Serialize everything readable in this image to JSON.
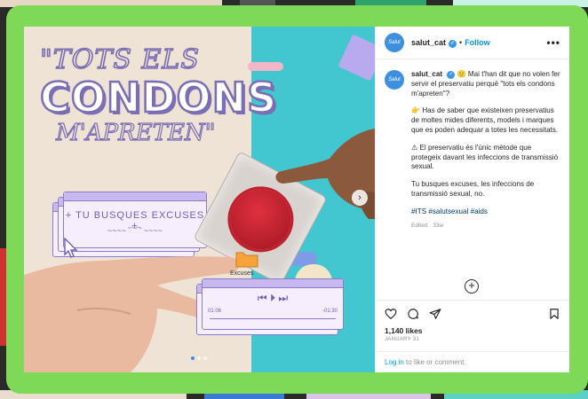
{
  "post": {
    "username": "salut_cat",
    "avatar_text": "Salut",
    "follow_label": "Follow",
    "header_separator": "•",
    "more_label": "•••",
    "caption": {
      "p1": "🙂 Mai t'han dit que no volen fer servir el preservatiu perquè \"tots els condons m'apreten\"?",
      "p2": "👉 Has de saber que existeixen preservatius de moltes mides diferents, models i marques que es poden adequar a totes les necessitats.",
      "p3": "⚠ El preservatiu és l'únic mètode que protegeix davant les infeccions de transmissió sexual.",
      "p4": "Tu busques excuses, les infeccions de transmissió sexual, no.",
      "hashtags": "#ITS #salutsexual #aids",
      "edited": "Edited · 33w"
    },
    "likes": "1,140 likes",
    "date": "JANUARY 31",
    "login_link": "Log in",
    "login_suffix": " to like or comment."
  },
  "media": {
    "headline_1": "\"TOTS ELS",
    "headline_2": "CONDONS",
    "headline_3": "M'APRETEN\"",
    "window_text": "+ TU BUSQUES EXCUSES +",
    "window_faces": "~~~~ ˘︶˘ ~~~~",
    "folder_label": "Excuses",
    "player_time_start": "01:06",
    "player_time_end": "-01:30",
    "player_controls": "⏮  ⏵  ⏭",
    "slide_count": 3,
    "active_slide": 0
  },
  "colors": {
    "frame": "#7ed957",
    "follow": "#0095f6",
    "accent_purple": "#7b6fb3",
    "teal": "#42c6cf"
  }
}
